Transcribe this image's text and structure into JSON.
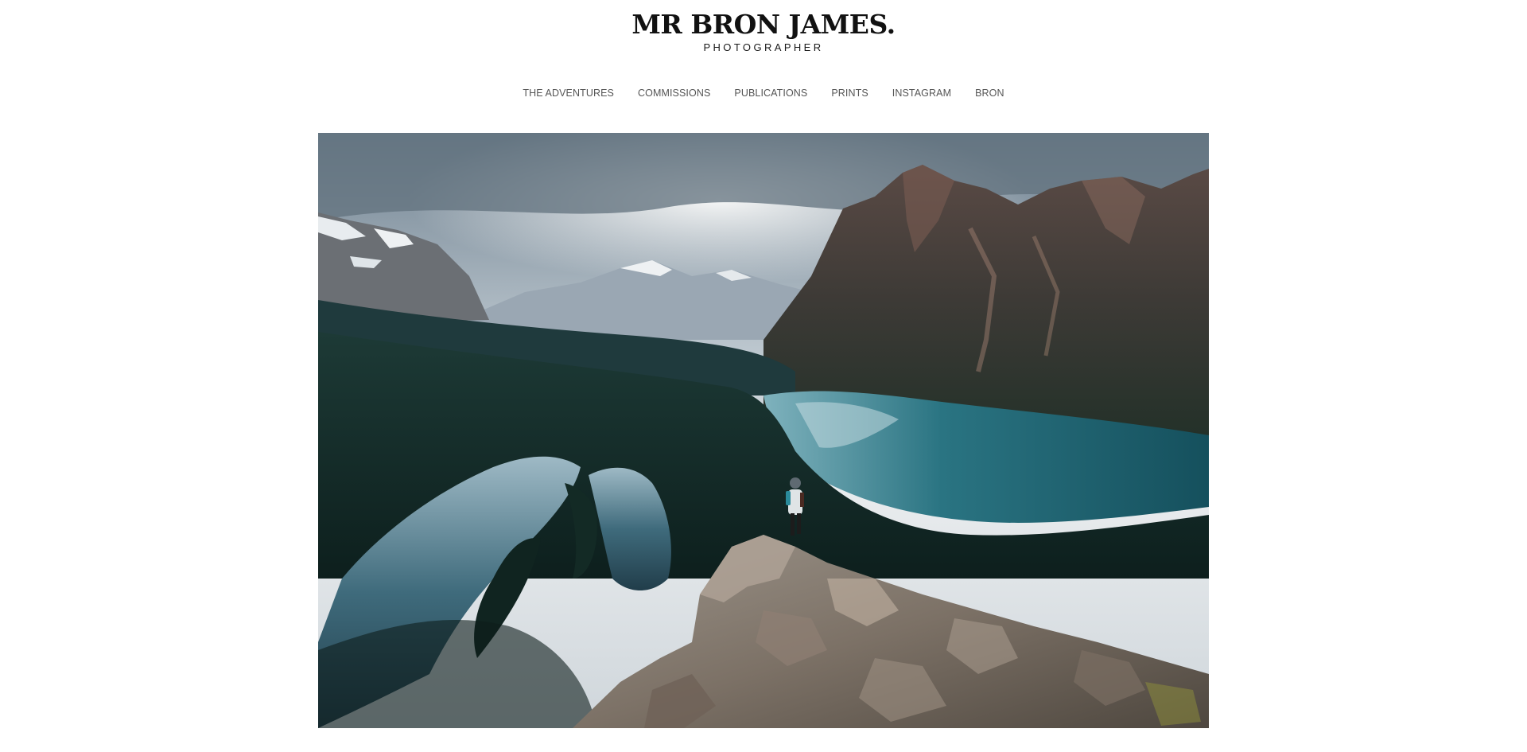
{
  "brand": {
    "title": "MR BRON JAMES.",
    "subtitle": "PHOTOGRAPHER"
  },
  "nav": {
    "items": [
      {
        "label": "THE ADVENTURES"
      },
      {
        "label": "COMMISSIONS"
      },
      {
        "label": "PUBLICATIONS"
      },
      {
        "label": "PRINTS"
      },
      {
        "label": "INSTAGRAM"
      },
      {
        "label": "BRON"
      }
    ]
  },
  "hero": {
    "subject": "hiker on rocky ledge above alpine lakes and mountains"
  },
  "colors": {
    "background": "#ffffff",
    "title": "#111111",
    "nav_text": "#555555"
  }
}
